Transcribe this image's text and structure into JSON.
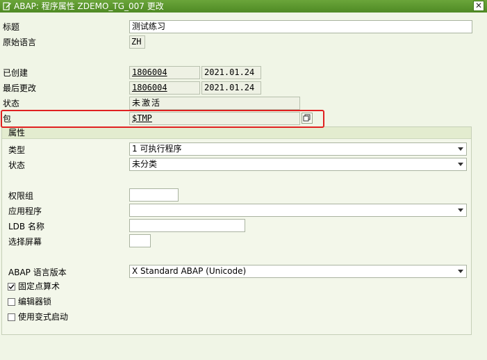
{
  "window": {
    "title": "ABAP: 程序属性 ZDEMO_TG_007 更改",
    "close_label": "✕"
  },
  "header": {
    "title_label": "标题",
    "title_value": "测试练习",
    "original_language_label": "原始语言",
    "original_language_value": "ZH",
    "created_label": "已创建",
    "created_user": "1806004",
    "created_date": "2021.01.24",
    "last_changed_label": "最后更改",
    "last_changed_user": "1806004",
    "last_changed_date": "2021.01.24",
    "status_label": "状态",
    "status_value": "未激活",
    "package_label": "包",
    "package_value": "$TMP"
  },
  "attributes": {
    "group_title": "属性",
    "type_label": "类型",
    "type_value": "1 可执行程序",
    "status_label": "状态",
    "status_value": "未分类",
    "auth_group_label": "权限组",
    "auth_group_value": "",
    "application_label": "应用程序",
    "application_value": "",
    "ldb_name_label": "LDB 名称",
    "ldb_name_value": "",
    "selection_screen_label": "选择屏幕",
    "selection_screen_value": "",
    "abap_version_label": "ABAP 语言版本",
    "abap_version_value": "X Standard ABAP (Unicode)",
    "checkboxes": [
      {
        "label": "固定点算术",
        "checked": true
      },
      {
        "label": "编辑器锁",
        "checked": false
      },
      {
        "label": "使用变式启动",
        "checked": false
      }
    ]
  },
  "colors": {
    "titlebar": "#5a9a2e",
    "highlight": "#e02020",
    "background": "#f0f5e6"
  }
}
